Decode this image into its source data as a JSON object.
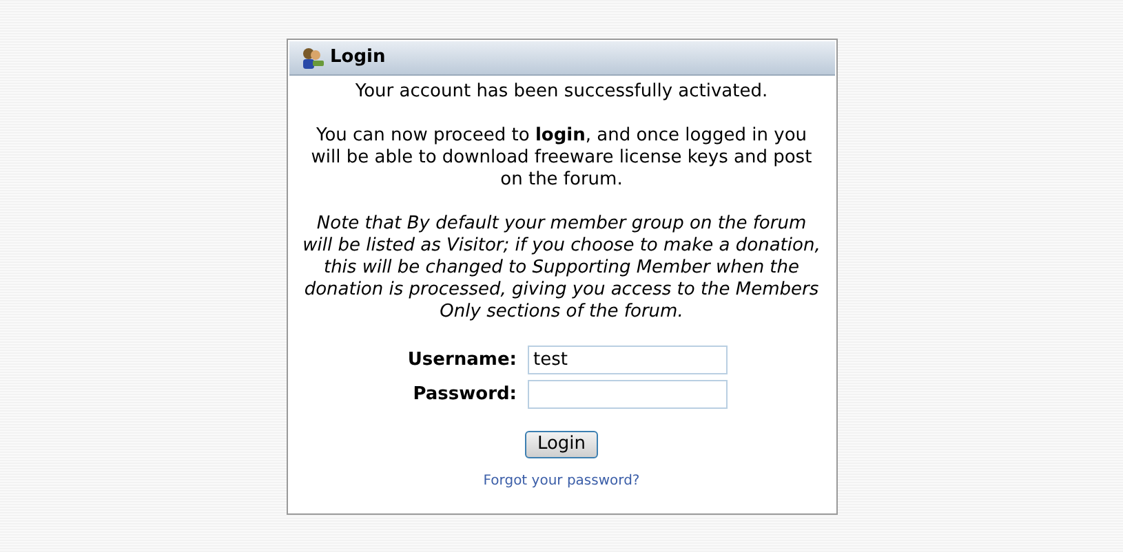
{
  "panel": {
    "title": "Login"
  },
  "messages": [
    {
      "text": "Your account has been successfully activated.",
      "kind": "plain"
    },
    {
      "text": "You can now proceed to **login**, and once logged in you will be able to download freeware license keys and post on the forum.",
      "kind": "plain"
    },
    {
      "text": "Note that By default your member group on the forum will be listed as Visitor; if you choose to make a donation, this will be changed to Supporting Member when the donation is processed, giving you access to the Members Only sections of the forum.",
      "kind": "note"
    }
  ],
  "form": {
    "fields": [
      {
        "label": "Username:",
        "value": "test"
      },
      {
        "label": "Password:"
      }
    ],
    "button": "Login",
    "link": "Forgot your password?"
  }
}
